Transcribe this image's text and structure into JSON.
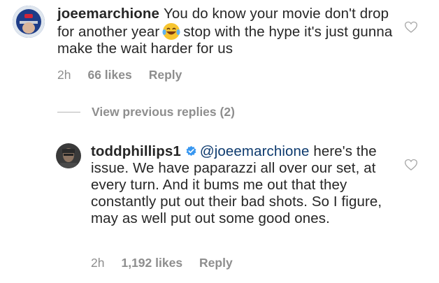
{
  "comment1": {
    "username": "joeemarchione",
    "text_before_emoji": "You do know your movie don't drop for another year",
    "emoji": "tears-of-joy-emoji",
    "text_after_emoji": "stop with the hype it's just gunna make the wait harder for us",
    "time": "2h",
    "likes": "66 likes",
    "reply": "Reply"
  },
  "view_previous": "View previous replies (2)",
  "comment2": {
    "username": "toddphillips1",
    "mention": "@joeemarchione",
    "text": "here's the issue. We have paparazzi all over our set, at every turn. And it bums me out that they constantly put out their bad shots. So I figure, may as well put out some good ones.",
    "time": "2h",
    "likes": "1,192 likes",
    "reply": "Reply"
  },
  "colors": {
    "text": "#262626",
    "meta": "#8e8e8e",
    "verified": "#3897f0",
    "mention": "#0d3a6e"
  }
}
